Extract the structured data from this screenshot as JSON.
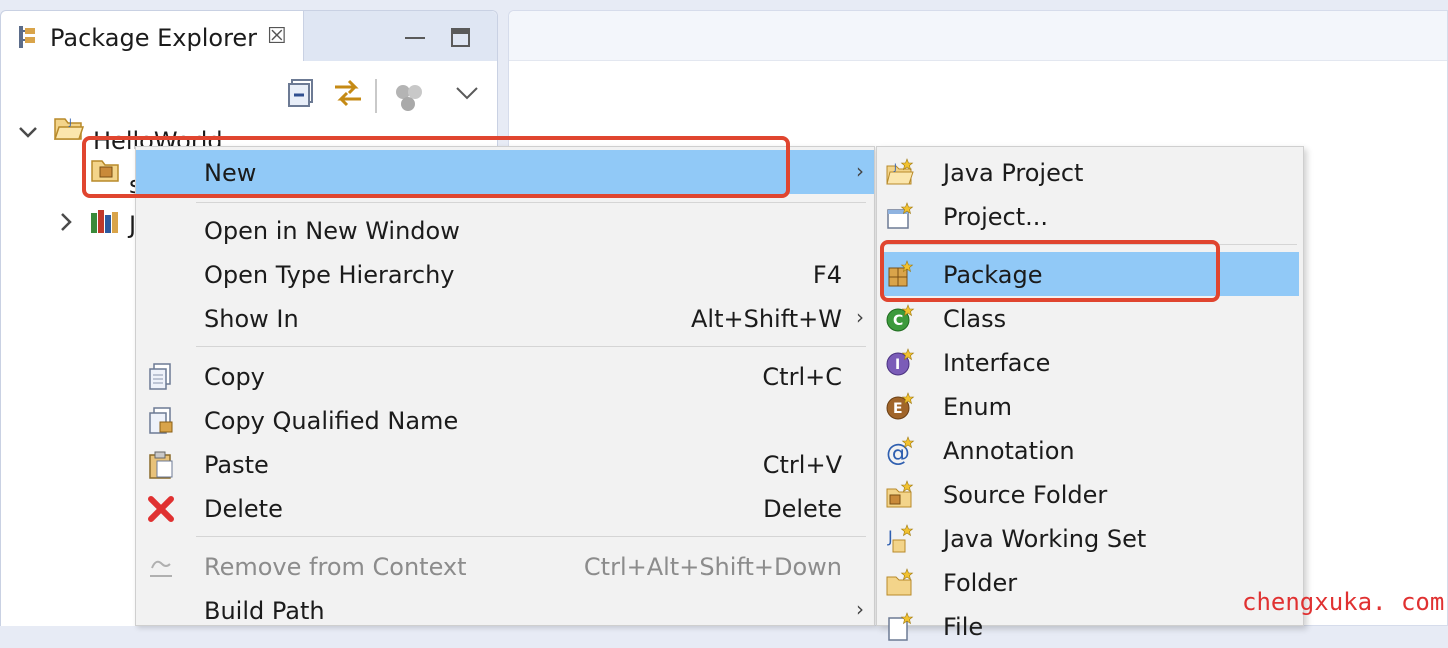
{
  "view": {
    "title": "Package Explorer",
    "close_glyph": "☒",
    "toolbar_icons": [
      "collapse-all-icon",
      "link-with-editor-icon",
      "focus-task-icon",
      "view-menu-icon"
    ]
  },
  "tree": {
    "project": {
      "label": "HelloWorld",
      "expanded": true,
      "icon": "project-folder-icon"
    },
    "src_partial": "s",
    "jre_partial": "J"
  },
  "context_menu": {
    "items": [
      {
        "label": "New",
        "arrow": "›",
        "highlighted": true
      },
      {
        "label": "Open in New Window"
      },
      {
        "label": "Open Type Hierarchy",
        "accel": "F4"
      },
      {
        "label": "Show In",
        "accel": "Alt+Shift+W",
        "arrow": "›"
      },
      {
        "label": "Copy",
        "accel": "Ctrl+C",
        "icon": "copy-icon"
      },
      {
        "label": "Copy Qualified Name",
        "icon": "copy-qualified-name-icon"
      },
      {
        "label": "Paste",
        "accel": "Ctrl+V",
        "icon": "paste-icon"
      },
      {
        "label": "Delete",
        "accel": "Delete",
        "icon": "delete-icon"
      },
      {
        "label": "Remove from Context",
        "accel": "Ctrl+Alt+Shift+Down",
        "disabled": true,
        "icon": "remove-context-icon"
      },
      {
        "label": "Build Path",
        "arrow": "›"
      }
    ]
  },
  "submenu": {
    "items": [
      {
        "label": "Java Project",
        "icon": "java-project-icon"
      },
      {
        "label": "Project...",
        "icon": "project-icon"
      },
      {
        "label": "Package",
        "icon": "package-icon",
        "highlighted": true
      },
      {
        "label": "Class",
        "icon": "class-icon"
      },
      {
        "label": "Interface",
        "icon": "interface-icon"
      },
      {
        "label": "Enum",
        "icon": "enum-icon"
      },
      {
        "label": "Annotation",
        "icon": "annotation-icon"
      },
      {
        "label": "Source Folder",
        "icon": "source-folder-icon"
      },
      {
        "label": "Java Working Set",
        "icon": "working-set-icon"
      },
      {
        "label": "Folder",
        "icon": "folder-icon"
      },
      {
        "label": "File",
        "icon": "file-icon"
      }
    ]
  },
  "colors": {
    "highlight": "#91c9f7",
    "callout": "#e0452f",
    "watermark": "#e03131"
  },
  "watermark": "chengxuka. com"
}
